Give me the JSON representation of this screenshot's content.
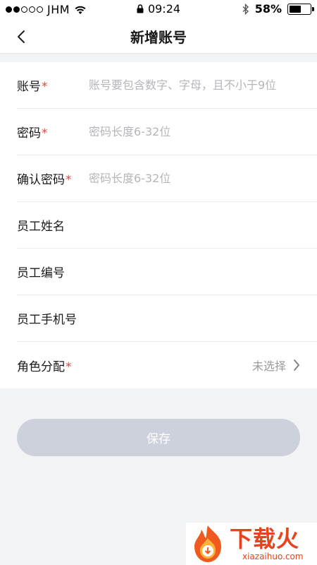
{
  "status_bar": {
    "carrier": "JHM",
    "time": "09:24",
    "battery": "58%",
    "battery_level": 0.58,
    "signal_bars_filled": 2,
    "signal_bars_total": 5
  },
  "nav": {
    "title": "新增账号",
    "back_icon": "chevron-left-icon"
  },
  "form": {
    "required_mark": "*",
    "account": {
      "label": "账号",
      "placeholder": "账号要包含数字、字母，且不小于9位",
      "value": ""
    },
    "password": {
      "label": "密码",
      "placeholder": "密码长度6-32位",
      "value": ""
    },
    "confirm_password": {
      "label": "确认密码",
      "placeholder": "密码长度6-32位",
      "value": ""
    },
    "staff_name": {
      "label": "员工姓名",
      "value": ""
    },
    "staff_number": {
      "label": "员工编号",
      "value": ""
    },
    "staff_phone": {
      "label": "员工手机号",
      "value": ""
    },
    "role": {
      "label": "角色分配",
      "value": "未选择"
    }
  },
  "save_button": {
    "label": "保存"
  },
  "watermark": {
    "title": "下载火",
    "subtitle": "xiazaihuo.com"
  },
  "colors": {
    "required": "#e2453c",
    "button_disabled": "#cdd1dc",
    "placeholder": "#b4b6bb",
    "background": "#f2f3f5",
    "brand": "#e8431c"
  }
}
